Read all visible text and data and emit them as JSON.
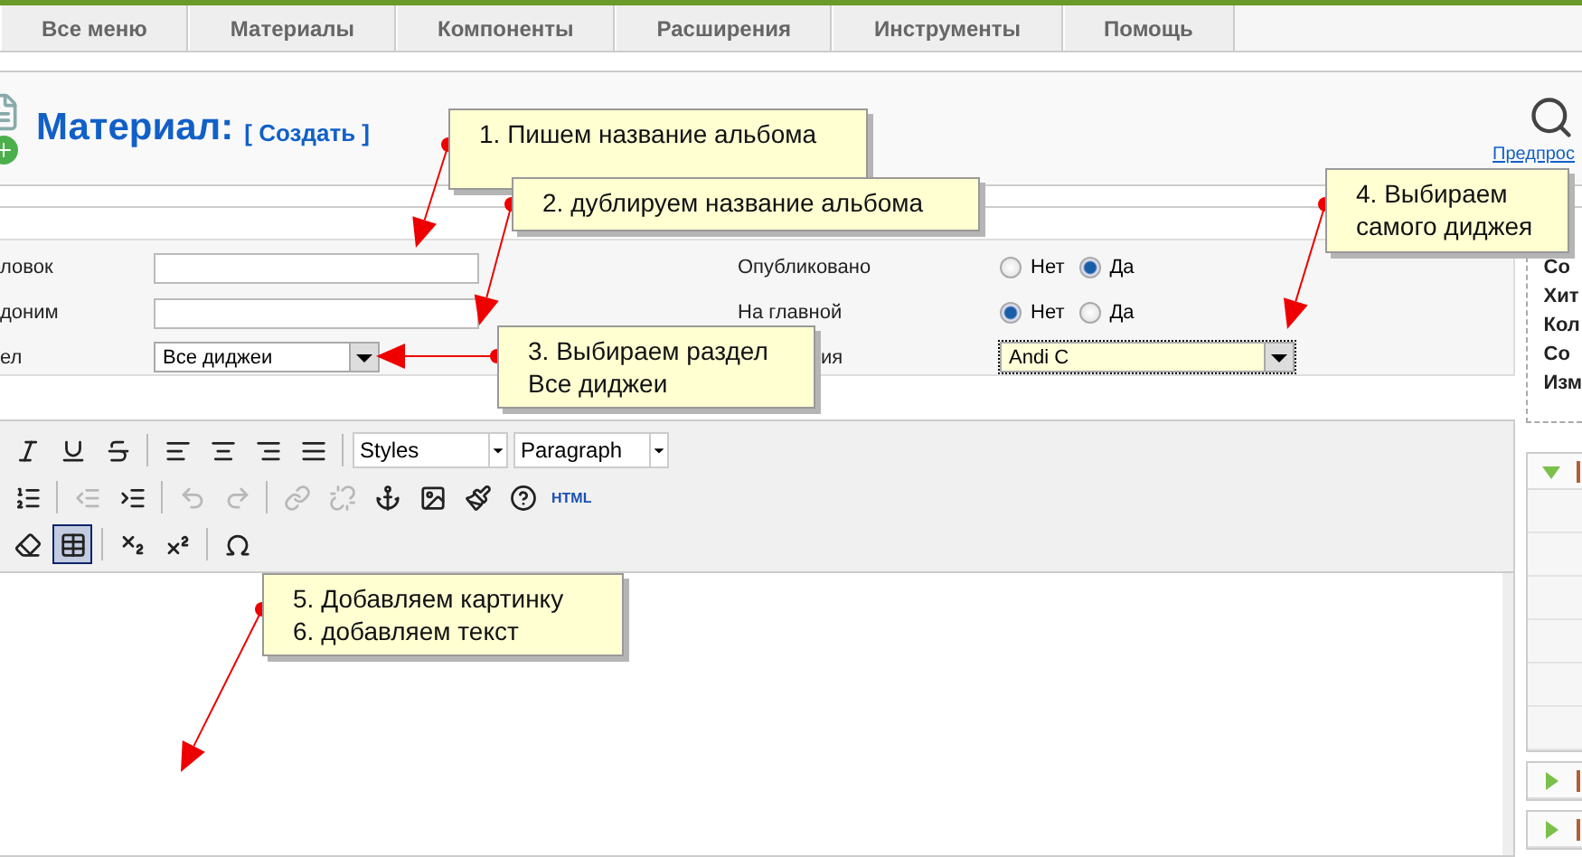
{
  "menu": [
    {
      "label": "Все меню"
    },
    {
      "label": "Материалы"
    },
    {
      "label": "Компоненты"
    },
    {
      "label": "Расширения"
    },
    {
      "label": "Инструменты"
    },
    {
      "label": "Помощь"
    }
  ],
  "header": {
    "title": "Материал:",
    "action": "[ Создать ]",
    "preview": "Предпрос"
  },
  "form_left": [
    {
      "label": "ловок",
      "kind": "input"
    },
    {
      "label": "доним",
      "kind": "input"
    },
    {
      "label": "ел",
      "kind": "select",
      "value": "Все диджеи"
    }
  ],
  "form_right": [
    {
      "label": "Опубликовано",
      "kind": "radio",
      "options": [
        {
          "label": "Нет",
          "selected": false
        },
        {
          "label": "Да",
          "selected": true
        }
      ]
    },
    {
      "label": "На главной",
      "kind": "radio",
      "options": [
        {
          "label": "Нет",
          "selected": true
        },
        {
          "label": "Да",
          "selected": false
        }
      ]
    },
    {
      "label": "ия",
      "kind": "select",
      "value": "Andi C",
      "focused": true
    }
  ],
  "info": [
    "Со",
    "Хит",
    "Кол",
    "Со",
    "Изм"
  ],
  "toolbar": [
    [
      {
        "kind": "icon",
        "disabled": false
      },
      {
        "kind": "icon",
        "disabled": false
      },
      {
        "kind": "icon",
        "disabled": false
      },
      {
        "kind": "separator"
      },
      {
        "kind": "icon",
        "disabled": false
      },
      {
        "kind": "icon",
        "disabled": false
      },
      {
        "kind": "icon",
        "disabled": false
      },
      {
        "kind": "icon",
        "disabled": false
      },
      {
        "kind": "separator"
      },
      {
        "kind": "select",
        "value": "Styles"
      },
      {
        "kind": "select",
        "value": "Paragraph"
      }
    ],
    [
      {
        "kind": "icon",
        "disabled": false
      },
      {
        "kind": "separator"
      },
      {
        "kind": "icon",
        "disabled": true
      },
      {
        "kind": "icon",
        "disabled": false
      },
      {
        "kind": "separator"
      },
      {
        "kind": "icon",
        "disabled": true
      },
      {
        "kind": "icon",
        "disabled": true
      },
      {
        "kind": "separator"
      },
      {
        "kind": "icon",
        "disabled": true
      },
      {
        "kind": "icon",
        "disabled": true
      },
      {
        "kind": "icon",
        "disabled": false
      },
      {
        "kind": "icon",
        "disabled": false
      },
      {
        "kind": "icon",
        "disabled": false
      },
      {
        "kind": "icon",
        "disabled": false
      },
      {
        "kind": "text",
        "label": "HTML"
      }
    ],
    [
      {
        "kind": "icon",
        "disabled": false
      },
      {
        "kind": "icon",
        "disabled": false,
        "selected": true
      },
      {
        "kind": "separator"
      },
      {
        "kind": "icon",
        "disabled": false
      },
      {
        "kind": "icon",
        "disabled": false
      },
      {
        "kind": "separator"
      },
      {
        "kind": "icon",
        "disabled": false
      }
    ]
  ],
  "side_panels": [
    {
      "expanded": true
    },
    {
      "expanded": false
    },
    {
      "expanded": false
    }
  ],
  "callouts": [
    {
      "lines": [
        "1. Пишем название альбома"
      ]
    },
    {
      "lines": [
        "2. дублируем название альбома"
      ]
    },
    {
      "lines": [
        "3. Выбираем раздел",
        "Все диджеи"
      ]
    },
    {
      "lines": [
        "4. Выбираем",
        "самого диджея"
      ]
    },
    {
      "lines": [
        "5. Добавляем картинку",
        "6. добавляем текст"
      ]
    }
  ]
}
